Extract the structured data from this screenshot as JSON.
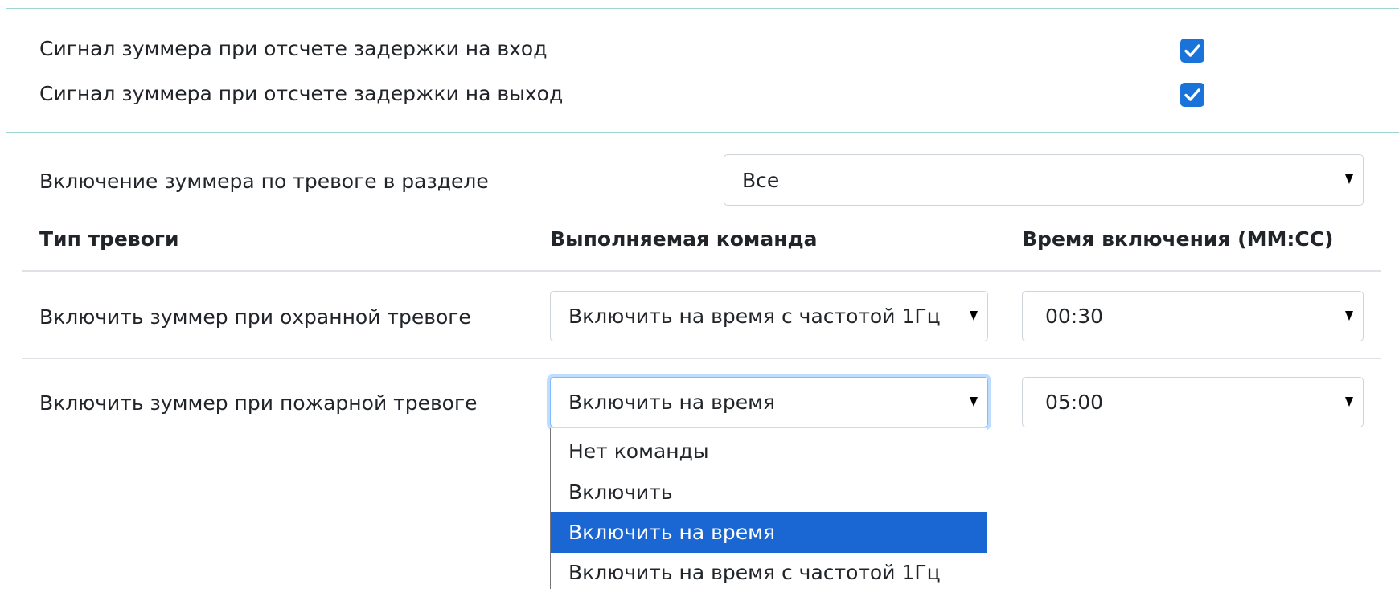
{
  "settings": {
    "entry_delay_label": "Сигнал зуммера при отсчете задержки на вход",
    "entry_delay_checked": true,
    "exit_delay_label": "Сигнал зуммера при отсчете задержки на выход",
    "exit_delay_checked": true
  },
  "partition": {
    "label": "Включение зуммера по тревоге в разделе",
    "selected": "Все"
  },
  "table": {
    "headers": {
      "alarm_type": "Тип тревоги",
      "command": "Выполняемая команда",
      "time": "Время включения (ММ:СС)"
    },
    "rows": [
      {
        "label": "Включить зуммер при охранной тревоге",
        "command": "Включить на время с частотой 1Гц",
        "time": "00:30"
      },
      {
        "label": "Включить зуммер при пожарной тревоге",
        "command": "Включить на время",
        "time": "05:00"
      }
    ]
  },
  "dropdown": {
    "options": [
      "Нет команды",
      "Включить",
      "Включить на время",
      "Включить на время с частотой 1Гц"
    ],
    "selected_index": 2
  },
  "colors": {
    "accent": "#1a73d8",
    "selected_option": "#1a66d2",
    "divider": "#9fd5d0"
  },
  "icons": {
    "checkbox": "check-icon",
    "select_arrow": "caret-down-icon"
  }
}
